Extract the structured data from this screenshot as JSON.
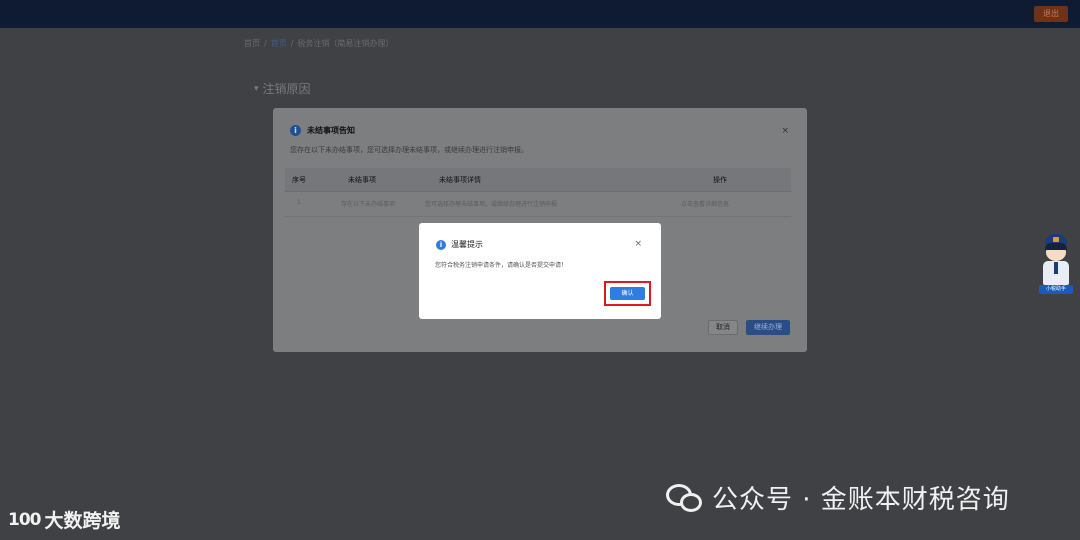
{
  "topbar": {
    "right_button": "退出"
  },
  "breadcrumb": {
    "items": [
      "首页",
      "首页",
      "税务注销（简易注销办理）"
    ],
    "separator": "/"
  },
  "section": {
    "title": "注销原因"
  },
  "notice_modal": {
    "title": "未结事项告知",
    "close": "×",
    "description": "您存在以下未办结事项，您可选择办理未结事项，或继续办理进行注销申报。",
    "columns": [
      "序号",
      "未结事项",
      "未结事项详情",
      "操作"
    ],
    "rows": [
      {
        "index": "1",
        "item": "存在以下未办结事项",
        "detail": "您可选择办理未结事项，或继续办理进行注销申报",
        "action": "点击查看详细信息"
      }
    ],
    "cancel_label": "取消",
    "continue_label": "继续办理"
  },
  "dialog": {
    "title": "温馨提示",
    "close": "×",
    "message": "您符合税务注销申请条件，请确认是否提交申请！",
    "confirm_label": "确认"
  },
  "assistant": {
    "tag": "小税助手",
    "icon": "tax-assistant-mascot"
  },
  "watermark_left": {
    "logo": "100",
    "text": "大数跨境"
  },
  "watermark_right": {
    "icon": "wechat-icon",
    "text": "公众号 · 金账本财税咨询"
  },
  "colors": {
    "accent": "#2f7de1",
    "highlight": "#e0191f",
    "topbar": "#0f1a33"
  }
}
